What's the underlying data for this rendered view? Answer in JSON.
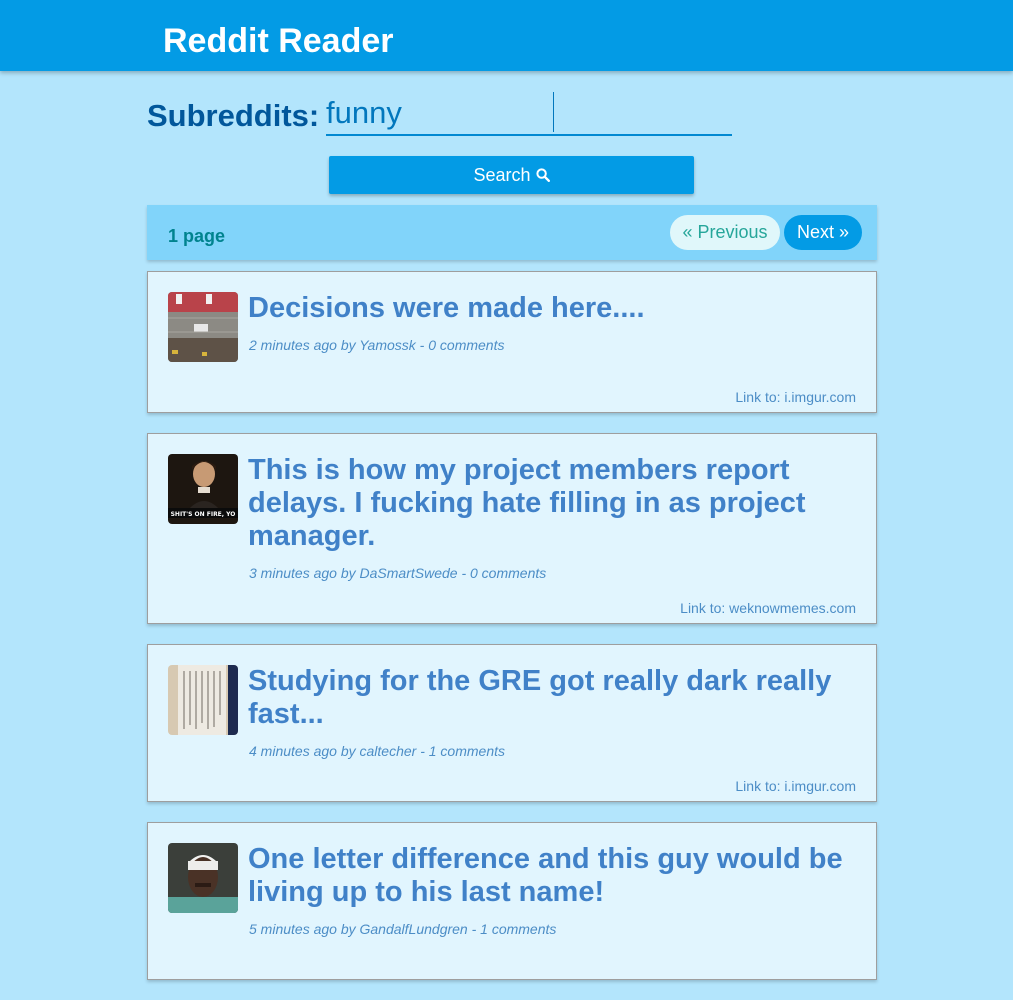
{
  "app": {
    "title": "Reddit Reader"
  },
  "search": {
    "label": "Subreddits:",
    "value": "funny",
    "button_label": "Search"
  },
  "pager": {
    "info": "1 page",
    "prev_label": "« Previous",
    "next_label": "Next »"
  },
  "posts": [
    {
      "title": "Decisions were made here....",
      "meta": "2 minutes ago by Yamossk - 0 comments",
      "link": "Link to: i.imgur.com"
    },
    {
      "title": "This is how my project members report delays. I fucking hate filling in as project manager.",
      "meta": "3 minutes ago by DaSmartSwede - 0 comments",
      "link": "Link to: weknowmemes.com",
      "thumb_caption": "SHIT'S ON FIRE, YO"
    },
    {
      "title": "Studying for the GRE got really dark really fast...",
      "meta": "4 minutes ago by caltecher - 1 comments",
      "link": "Link to: i.imgur.com"
    },
    {
      "title": "One letter difference and this guy would be living up to his last name!",
      "meta": "5 minutes ago by GandalfLundgren - 1 comments",
      "link": ""
    }
  ],
  "colors": {
    "background": "#b3e5fc",
    "appbar": "#039be5",
    "accent": "#039be5",
    "title_text": "#4081c8",
    "label_text": "#01579b"
  },
  "icons": {
    "search_button": "search-icon"
  }
}
